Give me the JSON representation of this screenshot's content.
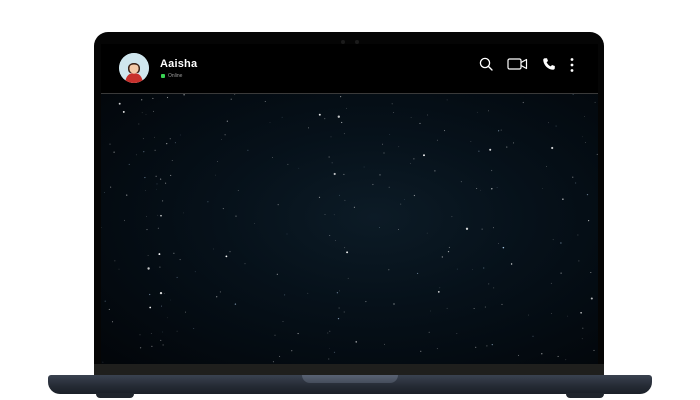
{
  "contact": {
    "name": "Aaisha",
    "status": "Online"
  },
  "icons": {
    "search": "search-icon",
    "video": "video-camera-icon",
    "call": "phone-icon",
    "menu": "more-vertical-icon"
  },
  "colors": {
    "online": "#39d353",
    "header_bg": "#000000",
    "body_bg": "#06111a"
  }
}
